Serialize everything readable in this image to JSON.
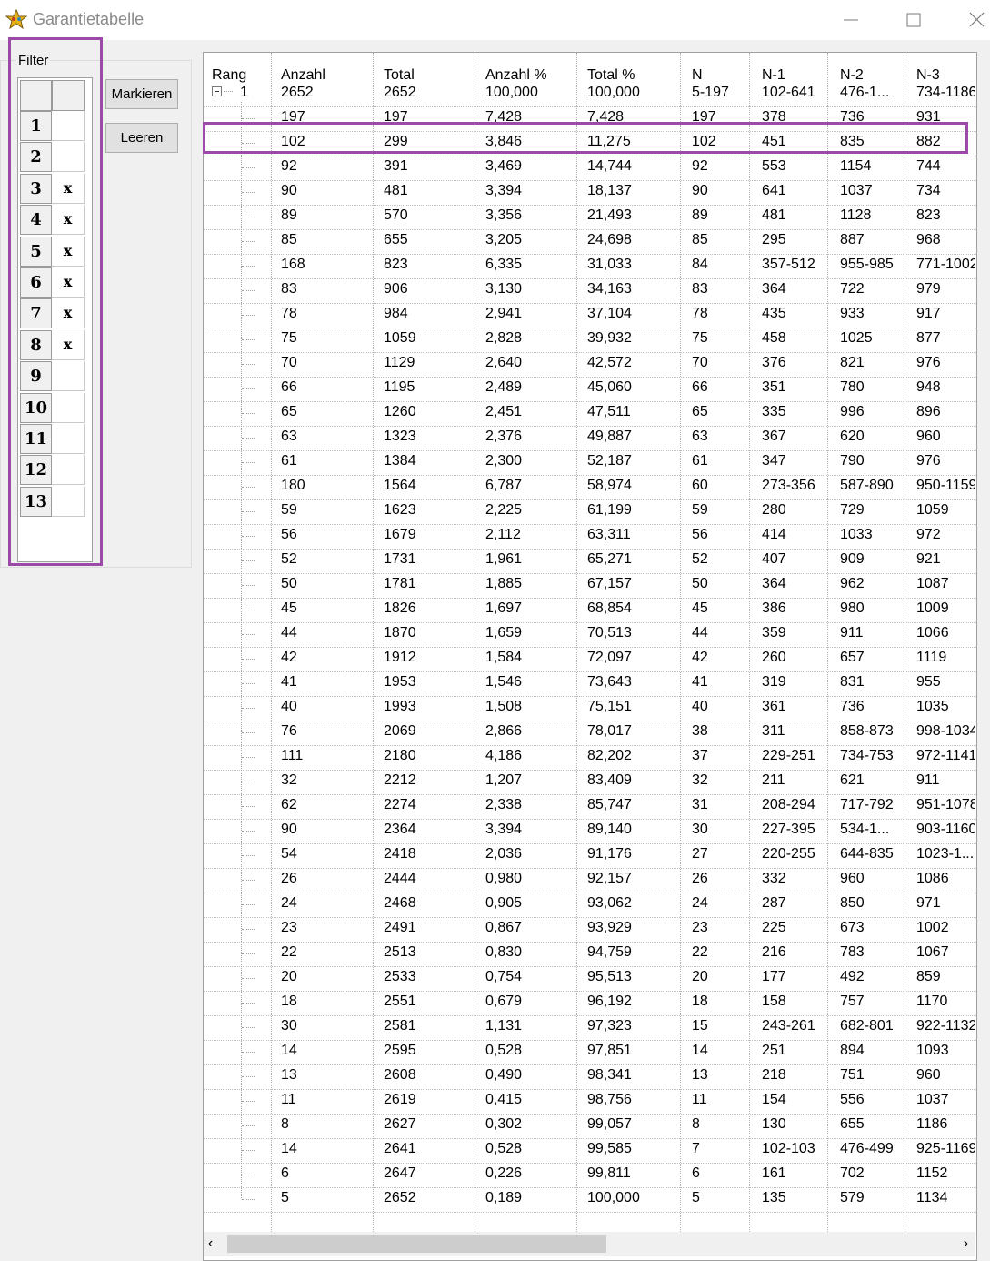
{
  "window": {
    "title": "Garantietabelle",
    "app_icon": "star-app-icon"
  },
  "filter": {
    "label": "Filter",
    "rows": [
      {
        "num": "1",
        "mark": ""
      },
      {
        "num": "2",
        "mark": ""
      },
      {
        "num": "3",
        "mark": "x"
      },
      {
        "num": "4",
        "mark": "x"
      },
      {
        "num": "5",
        "mark": "x"
      },
      {
        "num": "6",
        "mark": "x"
      },
      {
        "num": "7",
        "mark": "x"
      },
      {
        "num": "8",
        "mark": "x"
      },
      {
        "num": "9",
        "mark": ""
      },
      {
        "num": "10",
        "mark": ""
      },
      {
        "num": "11",
        "mark": ""
      },
      {
        "num": "12",
        "mark": ""
      },
      {
        "num": "13",
        "mark": ""
      }
    ]
  },
  "buttons": {
    "mark": "Markieren",
    "clear": "Leeren"
  },
  "table": {
    "columns": [
      "Rang",
      "Anzahl",
      "Total",
      "Anzahl %",
      "Total %",
      "N",
      "N-1",
      "N-2",
      "N-3"
    ],
    "root_rank": "1",
    "highlighted_row": 2,
    "rows": [
      [
        "2652",
        "2652",
        "100,000",
        "100,000",
        "5-197",
        "102-641",
        "476-1...",
        "734-1186"
      ],
      [
        "197",
        "197",
        "7,428",
        "7,428",
        "197",
        "378",
        "736",
        "931"
      ],
      [
        "102",
        "299",
        "3,846",
        "11,275",
        "102",
        "451",
        "835",
        "882"
      ],
      [
        "92",
        "391",
        "3,469",
        "14,744",
        "92",
        "553",
        "1154",
        "744"
      ],
      [
        "90",
        "481",
        "3,394",
        "18,137",
        "90",
        "641",
        "1037",
        "734"
      ],
      [
        "89",
        "570",
        "3,356",
        "21,493",
        "89",
        "481",
        "1128",
        "823"
      ],
      [
        "85",
        "655",
        "3,205",
        "24,698",
        "85",
        "295",
        "887",
        "968"
      ],
      [
        "168",
        "823",
        "6,335",
        "31,033",
        "84",
        "357-512",
        "955-985",
        "771-1002"
      ],
      [
        "83",
        "906",
        "3,130",
        "34,163",
        "83",
        "364",
        "722",
        "979"
      ],
      [
        "78",
        "984",
        "2,941",
        "37,104",
        "78",
        "435",
        "933",
        "917"
      ],
      [
        "75",
        "1059",
        "2,828",
        "39,932",
        "75",
        "458",
        "1025",
        "877"
      ],
      [
        "70",
        "1129",
        "2,640",
        "42,572",
        "70",
        "376",
        "821",
        "976"
      ],
      [
        "66",
        "1195",
        "2,489",
        "45,060",
        "66",
        "351",
        "780",
        "948"
      ],
      [
        "65",
        "1260",
        "2,451",
        "47,511",
        "65",
        "335",
        "996",
        "896"
      ],
      [
        "63",
        "1323",
        "2,376",
        "49,887",
        "63",
        "367",
        "620",
        "960"
      ],
      [
        "61",
        "1384",
        "2,300",
        "52,187",
        "61",
        "347",
        "790",
        "976"
      ],
      [
        "180",
        "1564",
        "6,787",
        "58,974",
        "60",
        "273-356",
        "587-890",
        "950-1159"
      ],
      [
        "59",
        "1623",
        "2,225",
        "61,199",
        "59",
        "280",
        "729",
        "1059"
      ],
      [
        "56",
        "1679",
        "2,112",
        "63,311",
        "56",
        "414",
        "1033",
        "972"
      ],
      [
        "52",
        "1731",
        "1,961",
        "65,271",
        "52",
        "407",
        "909",
        "921"
      ],
      [
        "50",
        "1781",
        "1,885",
        "67,157",
        "50",
        "364",
        "962",
        "1087"
      ],
      [
        "45",
        "1826",
        "1,697",
        "68,854",
        "45",
        "386",
        "980",
        "1009"
      ],
      [
        "44",
        "1870",
        "1,659",
        "70,513",
        "44",
        "359",
        "911",
        "1066"
      ],
      [
        "42",
        "1912",
        "1,584",
        "72,097",
        "42",
        "260",
        "657",
        "1119"
      ],
      [
        "41",
        "1953",
        "1,546",
        "73,643",
        "41",
        "319",
        "831",
        "955"
      ],
      [
        "40",
        "1993",
        "1,508",
        "75,151",
        "40",
        "361",
        "736",
        "1035"
      ],
      [
        "76",
        "2069",
        "2,866",
        "78,017",
        "38",
        "311",
        "858-873",
        "998-1034"
      ],
      [
        "111",
        "2180",
        "4,186",
        "82,202",
        "37",
        "229-251",
        "734-753",
        "972-1141"
      ],
      [
        "32",
        "2212",
        "1,207",
        "83,409",
        "32",
        "211",
        "621",
        "911"
      ],
      [
        "62",
        "2274",
        "2,338",
        "85,747",
        "31",
        "208-294",
        "717-792",
        "951-1078"
      ],
      [
        "90",
        "2364",
        "3,394",
        "89,140",
        "30",
        "227-395",
        "534-1...",
        "903-1160"
      ],
      [
        "54",
        "2418",
        "2,036",
        "91,176",
        "27",
        "220-255",
        "644-835",
        "1023-1..."
      ],
      [
        "26",
        "2444",
        "0,980",
        "92,157",
        "26",
        "332",
        "960",
        "1086"
      ],
      [
        "24",
        "2468",
        "0,905",
        "93,062",
        "24",
        "287",
        "850",
        "971"
      ],
      [
        "23",
        "2491",
        "0,867",
        "93,929",
        "23",
        "225",
        "673",
        "1002"
      ],
      [
        "22",
        "2513",
        "0,830",
        "94,759",
        "22",
        "216",
        "783",
        "1067"
      ],
      [
        "20",
        "2533",
        "0,754",
        "95,513",
        "20",
        "177",
        "492",
        "859"
      ],
      [
        "18",
        "2551",
        "0,679",
        "96,192",
        "18",
        "158",
        "757",
        "1170"
      ],
      [
        "30",
        "2581",
        "1,131",
        "97,323",
        "15",
        "243-261",
        "682-801",
        "922-1132"
      ],
      [
        "14",
        "2595",
        "0,528",
        "97,851",
        "14",
        "251",
        "894",
        "1093"
      ],
      [
        "13",
        "2608",
        "0,490",
        "98,341",
        "13",
        "218",
        "751",
        "960"
      ],
      [
        "11",
        "2619",
        "0,415",
        "98,756",
        "11",
        "154",
        "556",
        "1037"
      ],
      [
        "8",
        "2627",
        "0,302",
        "99,057",
        "8",
        "130",
        "655",
        "1186"
      ],
      [
        "14",
        "2641",
        "0,528",
        "99,585",
        "7",
        "102-103",
        "476-499",
        "925-1169"
      ],
      [
        "6",
        "2647",
        "0,226",
        "99,811",
        "6",
        "161",
        "702",
        "1152"
      ],
      [
        "5",
        "2652",
        "0,189",
        "100,000",
        "5",
        "135",
        "579",
        "1134"
      ]
    ]
  },
  "scrollbar": {
    "left_arrow": "‹",
    "right_arrow": "›"
  },
  "colors": {
    "highlight": "#9b4aa8",
    "window_bg": "#f0f0f0"
  }
}
